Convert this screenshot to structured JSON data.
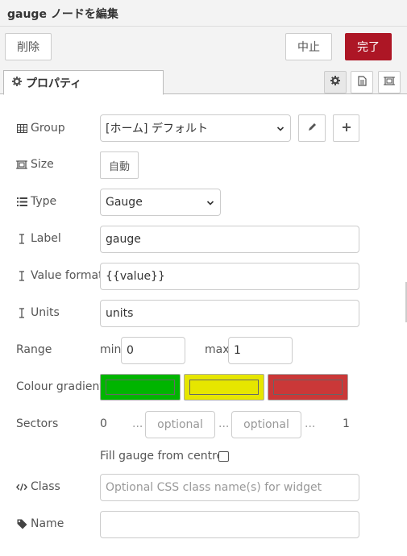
{
  "title": "gauge ノードを編集",
  "toolbar": {
    "delete_label": "削除",
    "cancel_label": "中止",
    "done_label": "完了"
  },
  "tab": {
    "label": "プロパティ"
  },
  "fields": {
    "group": {
      "label": "Group",
      "value": "[ホーム] デフォルト"
    },
    "size": {
      "label": "Size",
      "value": "自動"
    },
    "type": {
      "label": "Type",
      "value": "Gauge"
    },
    "label": {
      "label": "Label",
      "value": "gauge"
    },
    "value_format": {
      "label": "Value format",
      "value": "{{value}}"
    },
    "units": {
      "label": "Units",
      "value": "units"
    },
    "range": {
      "label": "Range",
      "min_label": "min",
      "min_value": "0",
      "max_label": "max",
      "max_value": "1"
    },
    "colour_gradient": {
      "label": "Colour gradient",
      "colors": [
        "#00b500",
        "#e6e600",
        "#ca3838"
      ]
    },
    "sectors": {
      "label": "Sectors",
      "start": "0",
      "end": "1",
      "ellipsis": "...",
      "placeholder1": "optional",
      "placeholder2": "optional"
    },
    "fill_centre": {
      "label": "Fill gauge from centre.",
      "checked": false
    },
    "class": {
      "label": "Class",
      "placeholder": "Optional CSS class name(s) for widget"
    },
    "name": {
      "label": "Name",
      "value": ""
    }
  }
}
